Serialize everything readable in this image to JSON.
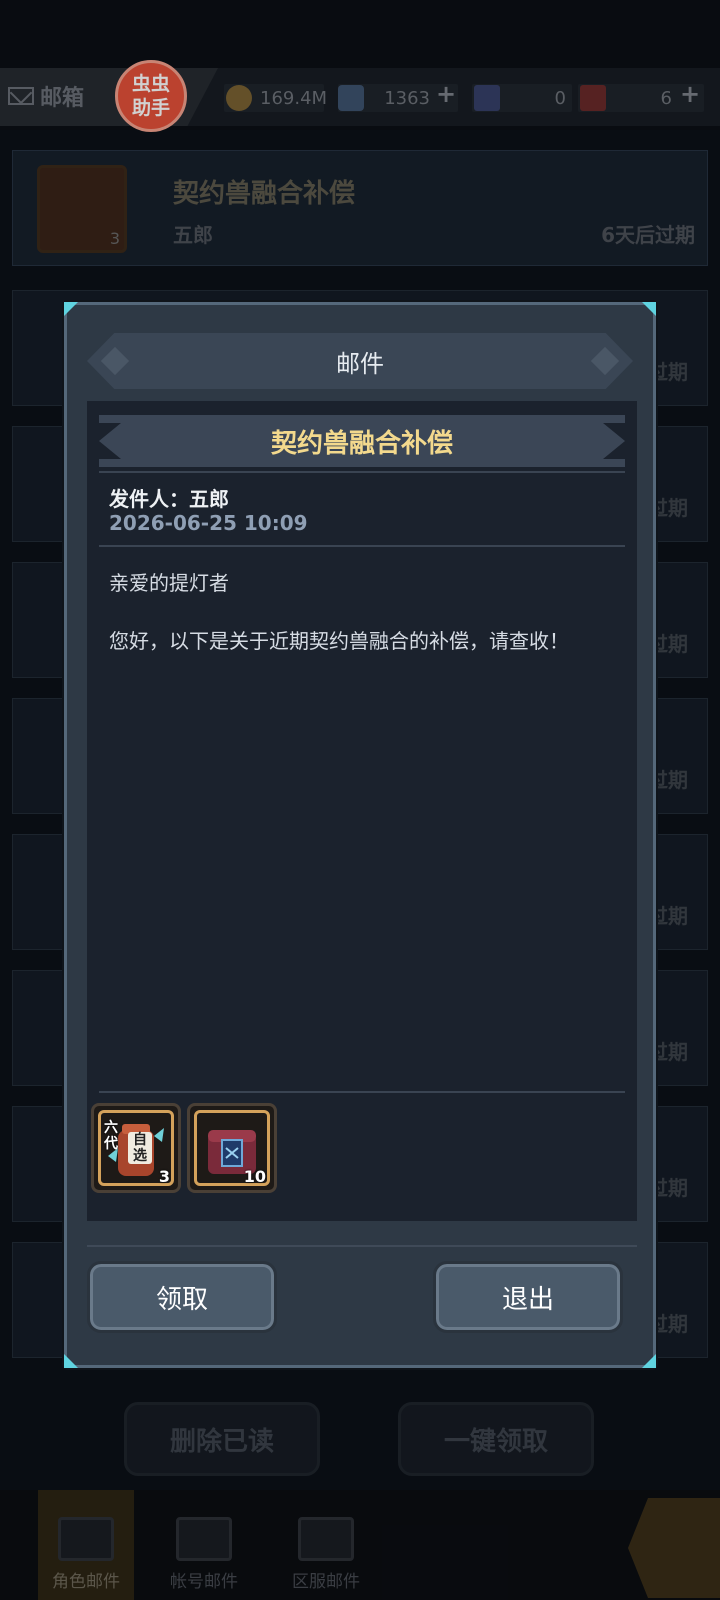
{
  "topbar": {
    "mailbox_label": "邮箱",
    "helper_badge": [
      "虫虫",
      "助手"
    ],
    "resources": [
      {
        "name": "coin",
        "value": "169.4M"
      },
      {
        "name": "crystal",
        "value": "1363"
      },
      {
        "name": "blue-card",
        "value": "0"
      },
      {
        "name": "red-card",
        "value": "6"
      }
    ]
  },
  "mail_list": {
    "first_row": {
      "title": "契约兽融合补偿",
      "sender": "五郎",
      "expiry": "6天后过期",
      "item_count": "3"
    },
    "ghost_expiry": "过期"
  },
  "dialog": {
    "header_title": "邮件",
    "subject": "契约兽融合补偿",
    "sender_line": "发件人：五郎",
    "date": "2026-06-25 10:09",
    "greeting": "亲爱的提灯者",
    "body": "您好，以下是关于近期契约兽融合的补偿，请查收！",
    "rewards": [
      {
        "name": "gen6-selector-box",
        "tag_top": "六代",
        "tag_pick": "自选",
        "quantity": "3"
      },
      {
        "name": "treasure-chest",
        "quantity": "10"
      }
    ],
    "claim_button": "领取",
    "exit_button": "退出"
  },
  "bottom_actions": {
    "delete_read": "删除已读",
    "claim_all": "一键领取"
  },
  "nav": {
    "items": [
      {
        "label": "角色邮件",
        "active": true
      },
      {
        "label": "帐号邮件",
        "active": false
      },
      {
        "label": "区服邮件",
        "active": false
      }
    ]
  },
  "colors": {
    "subject_gold": "#f3d98d",
    "date_blue": "#8f9fb4",
    "button_bg": "#4a5a6a",
    "corner_cyan": "#5fd3e0"
  }
}
